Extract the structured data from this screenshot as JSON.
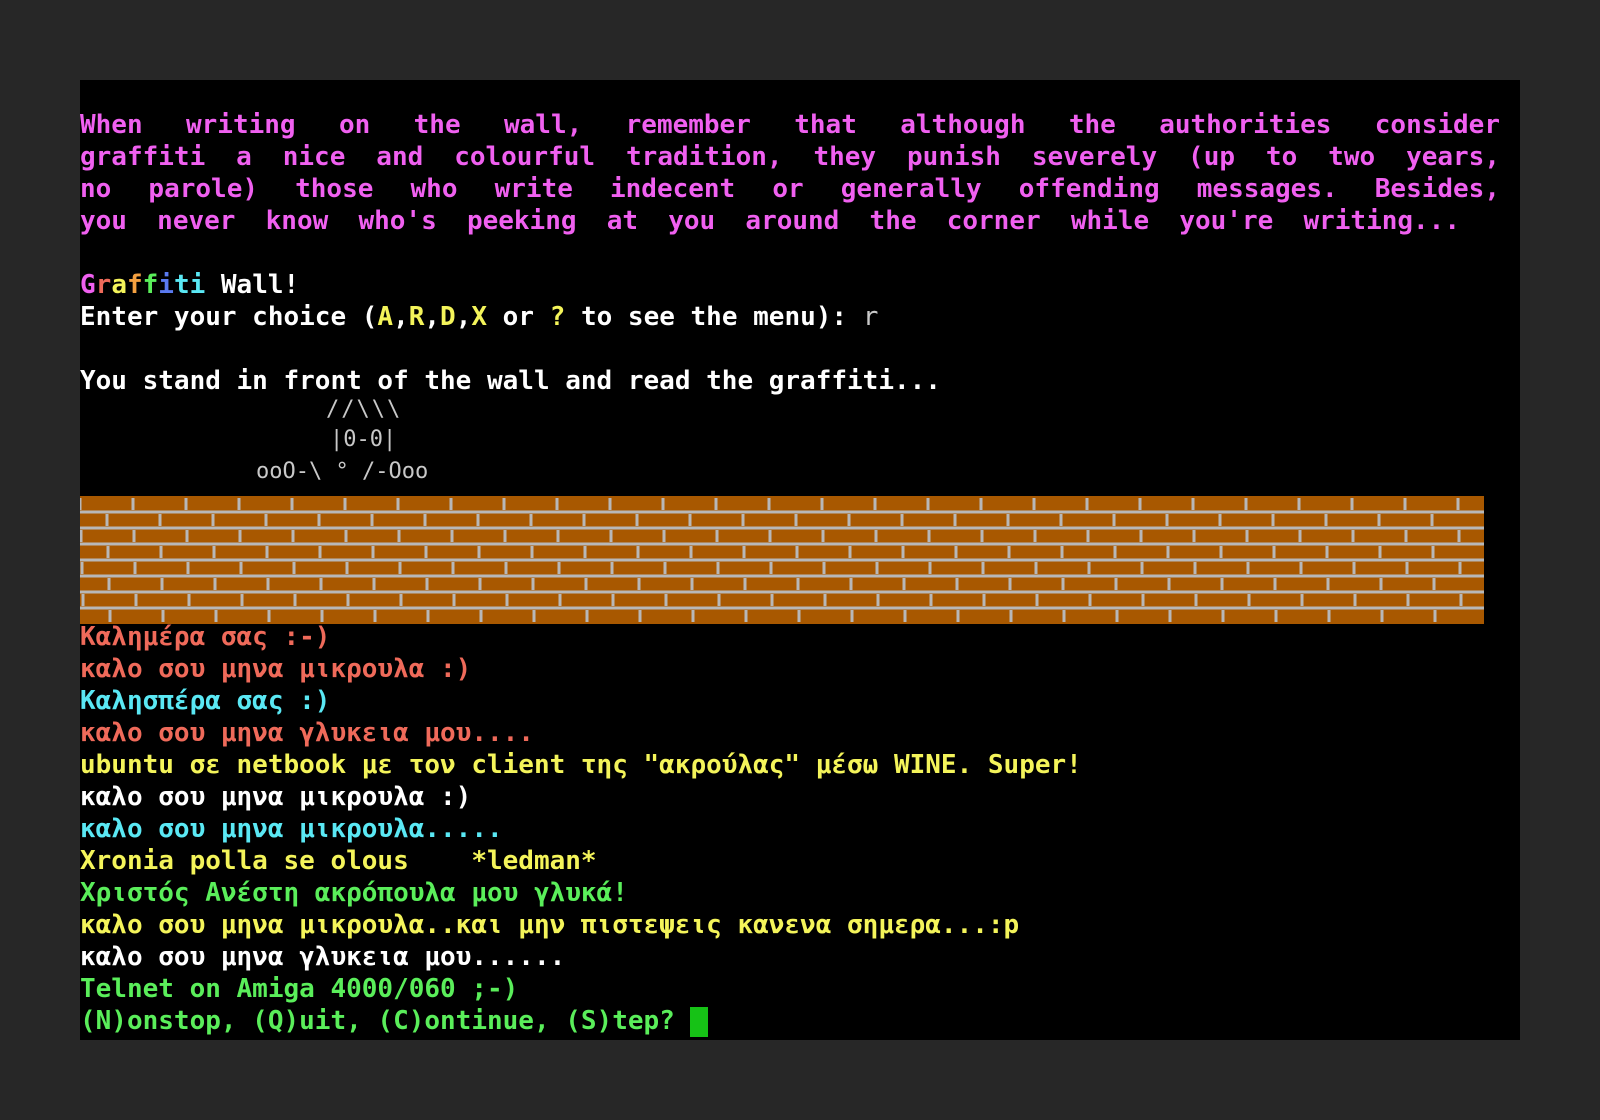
{
  "colors": {
    "magenta": "#f060f0",
    "white": "#ffffff",
    "yellow": "#f4f45a",
    "red": "#ef6a5a",
    "cyan": "#5ae8f4",
    "green": "#5aee5a",
    "gray": "#c8c8c8",
    "brick": "#a85800",
    "mortar": "#b8b8b8",
    "cursor": "#16c216"
  },
  "intro": [
    "When writing  on the wall,  remember  that although  the authorities   consider",
    "graffiti a nice and colourful tradition, they punish severely (up to two years,",
    "no parole) those who write indecent or generally  offending messages.  Besides,",
    "you never know who's peeking at you around the corner while you're writing..."
  ],
  "title": {
    "letters": [
      "G",
      "r",
      "a",
      "f",
      "f",
      "i",
      "t",
      "i"
    ],
    "letter_colors": [
      "#f060f0",
      "#ef6a5a",
      "#f4f45a",
      "#f4a040",
      "#5aee5a",
      "#5a7af0",
      "#5ae8f4",
      "#5ae8f4"
    ],
    "suffix": " Wall!"
  },
  "prompt": {
    "before": "Enter your choice (",
    "options": [
      "A",
      "R",
      "D",
      "X"
    ],
    "or": " or ",
    "help": "?",
    "after": " to see the menu): ",
    "input": "r"
  },
  "read_line": "You stand in front of the wall and read the graffiti...",
  "ascii_art": [
    "//\\\\\\",
    "|0-0|",
    "ooO-\\ ° /-Ooo"
  ],
  "graffiti": [
    {
      "text": "Καλημέρα σας :-)",
      "color": "#ef6a5a"
    },
    {
      "text": "καλο σου μηνα μικρουλα :)",
      "color": "#ef6a5a"
    },
    {
      "text": "Καλησπέρα σας :)",
      "color": "#5ae8f4"
    },
    {
      "text": "καλο σου μηνα γλυκεια μου....",
      "color": "#ef6a5a"
    },
    {
      "text": "ubuntu σε netbook με τον client της \"ακρούλας\" μέσω WINE. Super!",
      "color": "#f4f45a"
    },
    {
      "text": "καλο σου μηνα μικρουλα :)",
      "color": "#ffffff"
    },
    {
      "text": "καλο σου μηνα μικρουλα.....",
      "color": "#5ae8f4"
    },
    {
      "text": "Xronia polla se olous    *ledman*",
      "color": "#f4f45a"
    },
    {
      "text": "Χριστός Ανέστη ακρόπουλα μου γλυκά!",
      "color": "#5aee5a"
    },
    {
      "text": "καλο σου μηνα μικρουλα..και μην πιστεψεις κανενα σημερα...:p",
      "color": "#f4f45a"
    },
    {
      "text": "καλο σου μηνα γλυκεια μου......",
      "color": "#ffffff"
    },
    {
      "text": "Telnet on Amiga 4000/060 ;-)",
      "color": "#5aee5a"
    }
  ],
  "pager_prompt": "(N)onstop, (Q)uit, (C)ontinue, (S)tep? "
}
